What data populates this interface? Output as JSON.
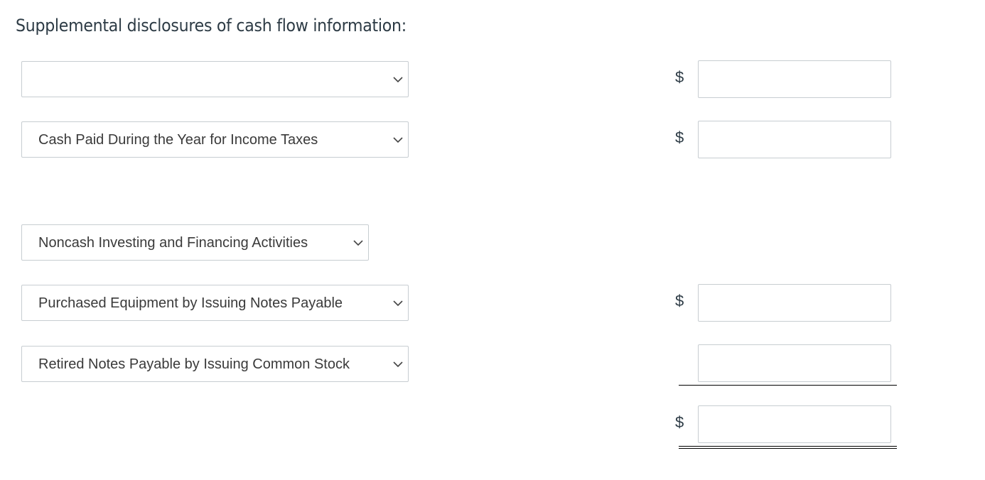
{
  "heading": "Supplemental disclosures of cash flow information:",
  "rows": [
    {
      "select_value": "",
      "currency": "$",
      "amount": ""
    },
    {
      "select_value": "Cash Paid During the Year for Income Taxes",
      "currency": "$",
      "amount": ""
    },
    {
      "select_value": "Noncash Investing and Financing Activities"
    },
    {
      "select_value": "Purchased Equipment by Issuing Notes Payable",
      "currency": "$",
      "amount": ""
    },
    {
      "select_value": "Retired Notes Payable by Issuing Common Stock",
      "amount": ""
    },
    {
      "currency": "$",
      "amount": ""
    }
  ],
  "icons": {
    "dropdown": "chevron-down-icon"
  }
}
